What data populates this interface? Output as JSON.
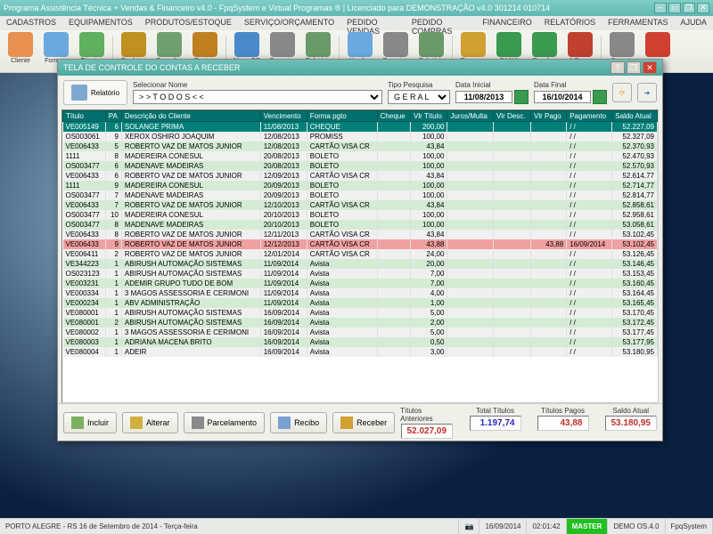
{
  "app": {
    "title": "Programa Assistência Técnica + Vendas & Financeiro v4.0 - FpqSystem e Virtual Programas ® | Licenciado para  DEMONSTRAÇÃO v4.0 301214 010714"
  },
  "menu": [
    "CADASTROS",
    "EQUIPAMENTOS",
    "PRODUTOS/ESTOQUE",
    "SERVIÇO/ORÇAMENTO",
    "PEDIDO VENDAS",
    "PEDIDO COMPRAS",
    "FINANCEIRO",
    "RELATÓRIOS",
    "FERRAMENTAS",
    "AJUDA"
  ],
  "toolbar": [
    {
      "label": "Cliente",
      "color": "#e89050"
    },
    {
      "label": "Fornece",
      "color": "#6aa8e0"
    },
    {
      "label": "Técnico",
      "color": "#60b060"
    },
    {
      "label": "Produtos",
      "color": "#c09020"
    },
    {
      "label": "Consultar",
      "color": "#70a070"
    },
    {
      "label": "Equipa.",
      "color": "#c08020"
    },
    {
      "label": "Menu OS",
      "color": "#4a8aca"
    },
    {
      "label": "Pesquisa",
      "color": "#888"
    },
    {
      "label": "Relatório",
      "color": "#6a9a6a"
    },
    {
      "label": "Vendas",
      "color": "#6aa8e0"
    },
    {
      "label": "Pesquisa",
      "color": "#888"
    },
    {
      "label": "Relatório",
      "color": "#6a9a6a"
    },
    {
      "label": "Finanças",
      "color": "#d0a030"
    },
    {
      "label": "CAIXA",
      "color": "#3a9a50"
    },
    {
      "label": "Receber",
      "color": "#3a9a50"
    },
    {
      "label": "A Pagar",
      "color": "#c04030"
    },
    {
      "label": "Suporte",
      "color": "#888"
    },
    {
      "label": "",
      "color": "#d04030"
    }
  ],
  "dialog": {
    "title": "TELA DE CONTROLE DO CONTAS A RECEBER",
    "report_btn": "Relatório",
    "name_label": "Selecionar Nome",
    "name_value": "> > T O D O S < <",
    "search_label": "Tipo  Pesquisa",
    "search_value": "G E R A L",
    "date_start_label": "Data Inicial",
    "date_start": "11/08/2013",
    "date_end_label": "Data Final",
    "date_end": "16/10/2014",
    "headers": [
      "Título",
      "PA",
      "Descrição do Cliente",
      "Vencimento",
      "Forma pgto",
      "Cheque",
      "Vlr Título",
      "Juros/Multa",
      "Vlr Desc.",
      "Vlr Pago",
      "Pagamento",
      "Saldo Atual"
    ],
    "rows": [
      {
        "sel": true,
        "cells": [
          "VE005149",
          "6",
          "SOLANGE PRIMA",
          "11/08/2013",
          "CHEQUE",
          "",
          "200,00",
          "",
          "",
          "",
          "/  /",
          "52.227,09"
        ]
      },
      {
        "cells": [
          "OS003061",
          "9",
          "XEROX OSHIRO JOAQUIM",
          "12/08/2013",
          "PROMISS",
          "",
          "100,00",
          "",
          "",
          "",
          "/  /",
          "52.327,09"
        ]
      },
      {
        "cells": [
          "VE006433",
          "5",
          "ROBERTO VAZ DE MATOS JUNIOR",
          "12/08/2013",
          "CARTÃO VISA  CR",
          "",
          "43,84",
          "",
          "",
          "",
          "/  /",
          "52.370,93"
        ]
      },
      {
        "cells": [
          "1111",
          "8",
          "MADEREIRA  CONESUL",
          "20/08/2013",
          "BOLETO",
          "",
          "100,00",
          "",
          "",
          "",
          "/  /",
          "52.470,93"
        ]
      },
      {
        "cells": [
          "OS003477",
          "6",
          "MADENAVE MADEIRAS",
          "20/08/2013",
          "BOLETO",
          "",
          "100,00",
          "",
          "",
          "",
          "/  /",
          "52.570,93"
        ]
      },
      {
        "cells": [
          "VE006433",
          "6",
          "ROBERTO VAZ DE MATOS JUNIOR",
          "12/09/2013",
          "CARTÃO VISA  CR",
          "",
          "43,84",
          "",
          "",
          "",
          "/  /",
          "52.614,77"
        ]
      },
      {
        "cells": [
          "1111",
          "9",
          "MADEREIRA  CONESUL",
          "20/09/2013",
          "BOLETO",
          "",
          "100,00",
          "",
          "",
          "",
          "/  /",
          "52.714,77"
        ]
      },
      {
        "cells": [
          "OS003477",
          "7",
          "MADENAVE MADEIRAS",
          "20/09/2013",
          "BOLETO",
          "",
          "100,00",
          "",
          "",
          "",
          "/  /",
          "52.814,77"
        ]
      },
      {
        "cells": [
          "VE006433",
          "7",
          "ROBERTO VAZ DE MATOS JUNIOR",
          "12/10/2013",
          "CARTÃO VISA  CR",
          "",
          "43,84",
          "",
          "",
          "",
          "/  /",
          "52.858,61"
        ]
      },
      {
        "cells": [
          "OS003477",
          "10",
          "MADEREIRA  CONESUL",
          "20/10/2013",
          "BOLETO",
          "",
          "100,00",
          "",
          "",
          "",
          "/  /",
          "52.958,61"
        ]
      },
      {
        "cells": [
          "OS003477",
          "8",
          "MADENAVE MADEIRAS",
          "20/10/2013",
          "BOLETO",
          "",
          "100,00",
          "",
          "",
          "",
          "/  /",
          "53.058,61"
        ]
      },
      {
        "cells": [
          "VE006433",
          "8",
          "ROBERTO VAZ DE MATOS JUNIOR",
          "12/11/2013",
          "CARTÃO VISA  CR",
          "",
          "43,84",
          "",
          "",
          "",
          "/  /",
          "53.102,45"
        ]
      },
      {
        "hl": true,
        "cells": [
          "VE006433",
          "9",
          "ROBERTO VAZ DE MATOS JUNIOR",
          "12/12/2013",
          "CARTÃO VISA  CR",
          "",
          "43,88",
          "",
          "",
          "43,88",
          "16/09/2014",
          "53.102,45"
        ]
      },
      {
        "cells": [
          "VE006411",
          "2",
          "ROBERTO VAZ DE MATOS JUNIOR",
          "12/01/2014",
          "CARTÃO VISA  CR",
          "",
          "24,00",
          "",
          "",
          "",
          "/  /",
          "53.126,45"
        ]
      },
      {
        "cells": [
          "VE344223",
          "1",
          "ABIRUSH AUTOMAÇÃO SISTEMAS",
          "11/09/2014",
          "Avista",
          "",
          "20,00",
          "",
          "",
          "",
          "/  /",
          "53.146,45"
        ]
      },
      {
        "cells": [
          "OS023123",
          "1",
          "ABIRUSH AUTOMAÇÃO SISTEMAS",
          "11/09/2014",
          "Avista",
          "",
          "7,00",
          "",
          "",
          "",
          "/  /",
          "53.153,45"
        ]
      },
      {
        "cells": [
          "VE003231",
          "1",
          "ADEMIR GRUPO TUDO DE BOM",
          "11/09/2014",
          "Avista",
          "",
          "7,00",
          "",
          "",
          "",
          "/  /",
          "53.160,45"
        ]
      },
      {
        "cells": [
          "VE000334",
          "1",
          "3 MAGOS ASSESSORIA E CERIMONI",
          "11/09/2014",
          "Avista",
          "",
          "4,00",
          "",
          "",
          "",
          "/  /",
          "53.164,45"
        ]
      },
      {
        "cells": [
          "VE000234",
          "1",
          "ABV ADMINISTRAÇÃO",
          "11/09/2014",
          "Avista",
          "",
          "1,00",
          "",
          "",
          "",
          "/  /",
          "53.165,45"
        ]
      },
      {
        "cells": [
          "VE080001",
          "1",
          "ABIRUSH AUTOMAÇÃO SISTEMAS",
          "16/09/2014",
          "Avista",
          "",
          "5,00",
          "",
          "",
          "",
          "/  /",
          "53.170,45"
        ]
      },
      {
        "cells": [
          "VE080001",
          "2",
          "ABIRUSH AUTOMAÇÃO SISTEMAS",
          "16/09/2014",
          "Avista",
          "",
          "2,00",
          "",
          "",
          "",
          "/  /",
          "53.172,45"
        ]
      },
      {
        "cells": [
          "VE080002",
          "1",
          "3 MAGOS ASSESSORIA E CERIMONI",
          "16/09/2014",
          "Avista",
          "",
          "5,00",
          "",
          "",
          "",
          "/  /",
          "53.177,45"
        ]
      },
      {
        "cells": [
          "VE080003",
          "1",
          "ADRIANA MACENA BRITO",
          "16/09/2014",
          "Avista",
          "",
          "0,50",
          "",
          "",
          "",
          "/  /",
          "53.177,95"
        ]
      },
      {
        "cells": [
          "VE080004",
          "1",
          "ADEIR",
          "16/09/2014",
          "Avista",
          "",
          "3,00",
          "",
          "",
          "",
          "/  /",
          "53.180,95"
        ]
      }
    ],
    "buttons": {
      "incluir": "Incluir",
      "alterar": "Alterar",
      "parcelamento": "Parcelamento",
      "recibo": "Recibo",
      "receber": "Receber"
    },
    "totals": {
      "anteriores_label": "Títulos Anteriores",
      "anteriores": "52.027,09",
      "total_label": "Total Títulos",
      "total": "1.197,74",
      "pagos_label": "Títulos Pagos",
      "pagos": "43,88",
      "saldo_label": "Saldo Atual",
      "saldo": "53.180,95"
    }
  },
  "status": {
    "city": "PORTO ALEGRE - RS 16 de Setembro de 2014 - Terça-feira",
    "date": "16/09/2014",
    "time": "02:01:42",
    "user": "MASTER",
    "demo": "DEMO OS.4.0",
    "brand": "FpqSystem"
  },
  "colors": {
    "accent": "#00807c",
    "green": "#20c020",
    "red": "#c03028",
    "blue": "#2a4ac0"
  }
}
